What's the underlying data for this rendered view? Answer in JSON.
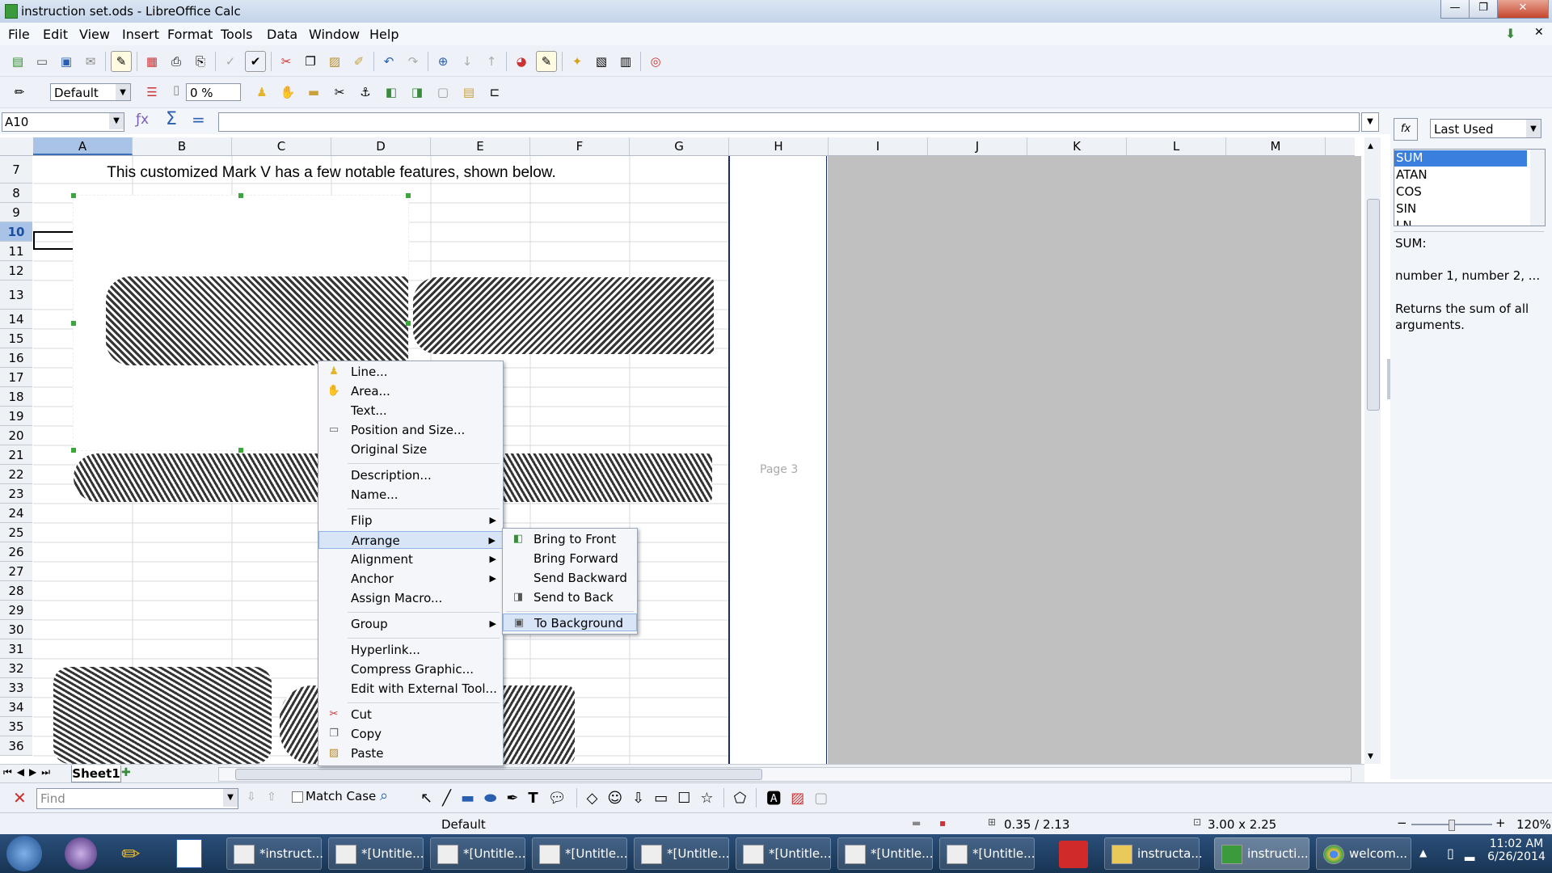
{
  "window": {
    "title": "instruction set.ods - LibreOffice Calc"
  },
  "menu": [
    "File",
    "Edit",
    "View",
    "Insert",
    "Format",
    "Tools",
    "Data",
    "Window",
    "Help"
  ],
  "toolbar2": {
    "style": "Default",
    "percent": "0 %"
  },
  "formula_bar": {
    "name_box": "A10",
    "content": ""
  },
  "columns": [
    "A",
    "B",
    "C",
    "D",
    "E",
    "F",
    "G",
    "H",
    "I",
    "J",
    "K",
    "L",
    "M"
  ],
  "rows": [
    "7",
    "8",
    "9",
    "10",
    "11",
    "12",
    "13",
    "14",
    "15",
    "16",
    "17",
    "18",
    "19",
    "20",
    "21",
    "22",
    "23",
    "24",
    "25",
    "26",
    "27",
    "28",
    "29",
    "30",
    "31",
    "32",
    "33",
    "34",
    "35",
    "36"
  ],
  "cell_text": "This customized Mark V has a few notable features, shown below.",
  "page_label": "Page 3",
  "context_menu": {
    "items": [
      "Line...",
      "Area...",
      "Text...",
      "Position and Size...",
      "Original Size",
      "Description...",
      "Name...",
      "Flip",
      "Arrange",
      "Alignment",
      "Anchor",
      "Assign Macro...",
      "Group",
      "Hyperlink...",
      "Compress Graphic...",
      "Edit with External Tool...",
      "Cut",
      "Copy",
      "Paste"
    ]
  },
  "submenu": {
    "items": [
      "Bring to Front",
      "Bring Forward",
      "Send Backward",
      "Send to Back",
      "To Background"
    ]
  },
  "sidebar": {
    "category": "Last Used",
    "functions": [
      "SUM",
      "ATAN",
      "COS",
      "SIN",
      "LN"
    ],
    "selected": "SUM",
    "func_title": "SUM:",
    "func_args": "number 1, number 2, ...",
    "func_desc": "Returns the sum of all arguments."
  },
  "sheet_tab": "Sheet1",
  "find_bar": {
    "placeholder": "Find",
    "match_case": "Match Case"
  },
  "statusbar": {
    "style": "Default",
    "position": "0.35 / 2.13",
    "size": "3.00 x 2.25",
    "zoom": "120%"
  },
  "taskbar": {
    "tasks": [
      "*instruct...",
      "*[Untitle...",
      "*[Untitle...",
      "*[Untitle...",
      "*[Untitle...",
      "*[Untitle...",
      "*[Untitle...",
      "*[Untitle...",
      "instructa...",
      "instructi...",
      "welcom..."
    ],
    "time": "11:02 AM",
    "date": "6/26/2014"
  }
}
